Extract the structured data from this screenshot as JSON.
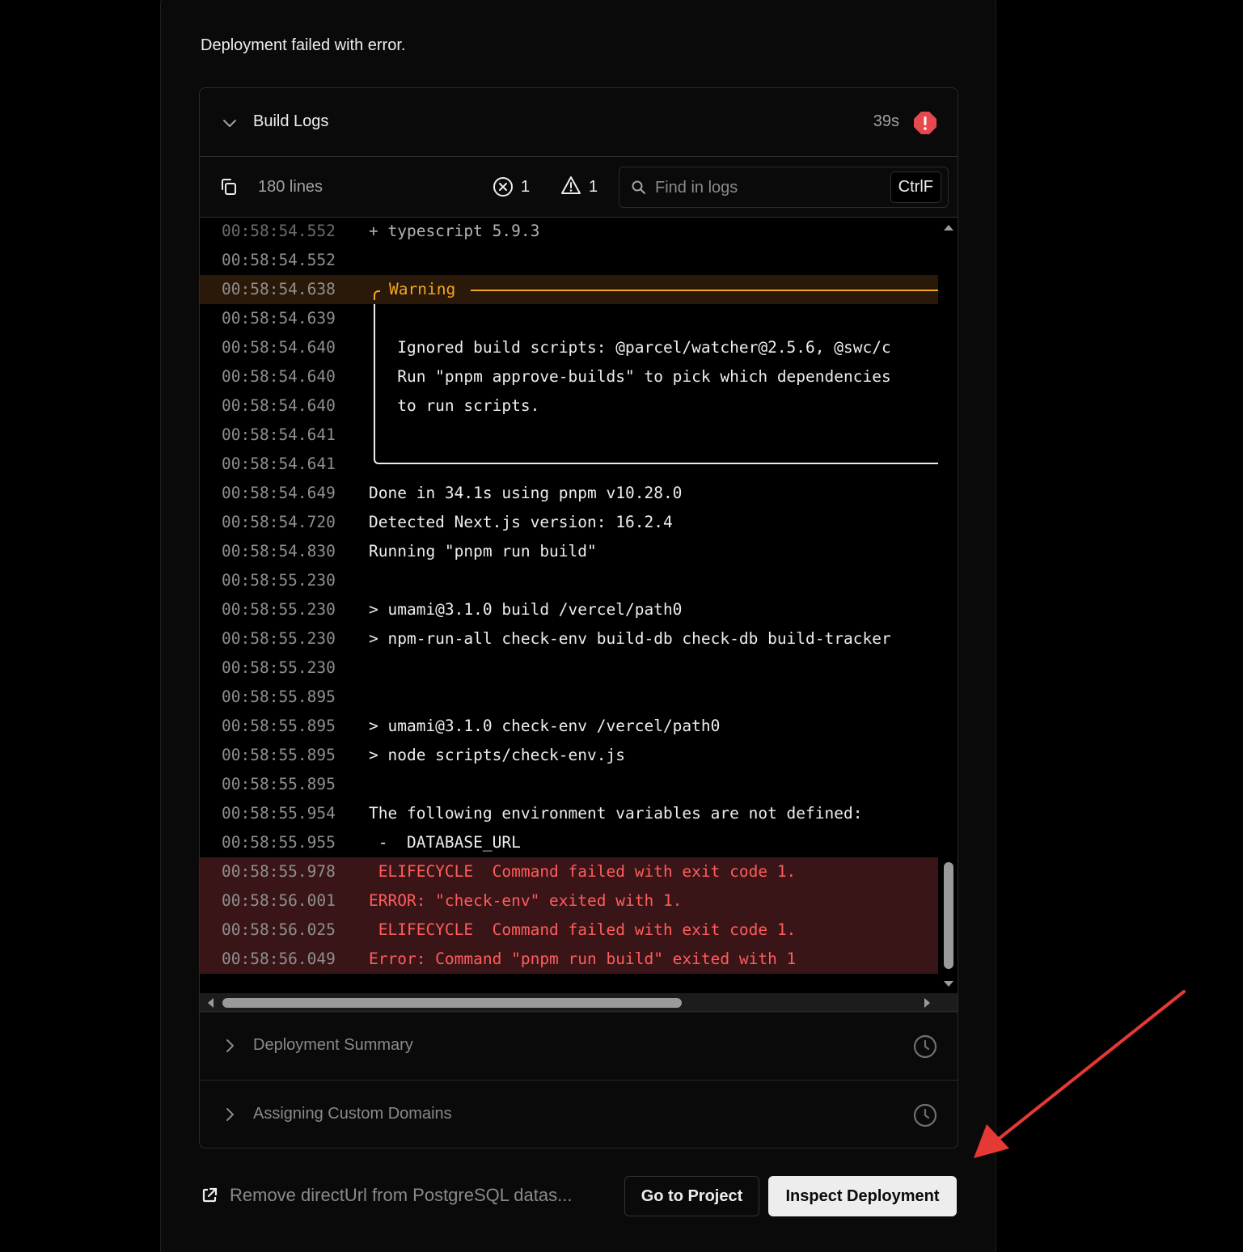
{
  "status_message": "Deployment failed with error.",
  "build_logs": {
    "title": "Build Logs",
    "duration": "39s",
    "line_count": "180 lines",
    "error_count": "1",
    "warning_count": "1",
    "search_placeholder": "Find in logs",
    "search_shortcut": "CtrlF",
    "lines": [
      {
        "ts": "00:58:54.552",
        "msg": "+ typescript 5.9.3",
        "kind": "faded"
      },
      {
        "ts": "00:58:54.552",
        "msg": "",
        "kind": "normal"
      },
      {
        "ts": "00:58:54.638",
        "msg": "Warning",
        "kind": "warning"
      },
      {
        "ts": "00:58:54.639",
        "msg": "",
        "kind": "normal"
      },
      {
        "ts": "00:58:54.640",
        "msg": "   Ignored build scripts: @parcel/watcher@2.5.6, @swc/c",
        "kind": "normal"
      },
      {
        "ts": "00:58:54.640",
        "msg": "   Run \"pnpm approve-builds\" to pick which dependencies",
        "kind": "normal"
      },
      {
        "ts": "00:58:54.640",
        "msg": "   to run scripts.",
        "kind": "normal"
      },
      {
        "ts": "00:58:54.641",
        "msg": "",
        "kind": "normal"
      },
      {
        "ts": "00:58:54.641",
        "msg": "",
        "kind": "normal"
      },
      {
        "ts": "00:58:54.649",
        "msg": "Done in 34.1s using pnpm v10.28.0",
        "kind": "normal"
      },
      {
        "ts": "00:58:54.720",
        "msg": "Detected Next.js version: 16.2.4",
        "kind": "normal"
      },
      {
        "ts": "00:58:54.830",
        "msg": "Running \"pnpm run build\"",
        "kind": "normal"
      },
      {
        "ts": "00:58:55.230",
        "msg": "",
        "kind": "normal"
      },
      {
        "ts": "00:58:55.230",
        "msg": "> umami@3.1.0 build /vercel/path0",
        "kind": "normal"
      },
      {
        "ts": "00:58:55.230",
        "msg": "> npm-run-all check-env build-db check-db build-tracker",
        "kind": "normal"
      },
      {
        "ts": "00:58:55.230",
        "msg": "",
        "kind": "normal"
      },
      {
        "ts": "00:58:55.895",
        "msg": "",
        "kind": "normal"
      },
      {
        "ts": "00:58:55.895",
        "msg": "> umami@3.1.0 check-env /vercel/path0",
        "kind": "normal"
      },
      {
        "ts": "00:58:55.895",
        "msg": "> node scripts/check-env.js",
        "kind": "normal"
      },
      {
        "ts": "00:58:55.895",
        "msg": "",
        "kind": "normal"
      },
      {
        "ts": "00:58:55.954",
        "msg": "The following environment variables are not defined:",
        "kind": "normal"
      },
      {
        "ts": "00:58:55.955",
        "msg": " -  DATABASE_URL",
        "kind": "normal"
      },
      {
        "ts": "00:58:55.978",
        "msg": " ELIFECYCLE  Command failed with exit code 1.",
        "kind": "error"
      },
      {
        "ts": "00:58:56.001",
        "msg": "ERROR: \"check-env\" exited with 1.",
        "kind": "error"
      },
      {
        "ts": "00:58:56.025",
        "msg": " ELIFECYCLE  Command failed with exit code 1.",
        "kind": "error"
      },
      {
        "ts": "00:58:56.049",
        "msg": "Error: Command \"pnpm run build\" exited with 1",
        "kind": "error"
      }
    ]
  },
  "sections": [
    {
      "label": "Deployment Summary"
    },
    {
      "label": "Assigning Custom Domains"
    }
  ],
  "footer": {
    "commit_link": "Remove directUrl from PostgreSQL datas...",
    "go_to_project": "Go to Project",
    "inspect_deployment": "Inspect Deployment"
  },
  "colors": {
    "error": "#e5484d",
    "warning": "#f5a623",
    "annotation_arrow": "#e53935"
  }
}
